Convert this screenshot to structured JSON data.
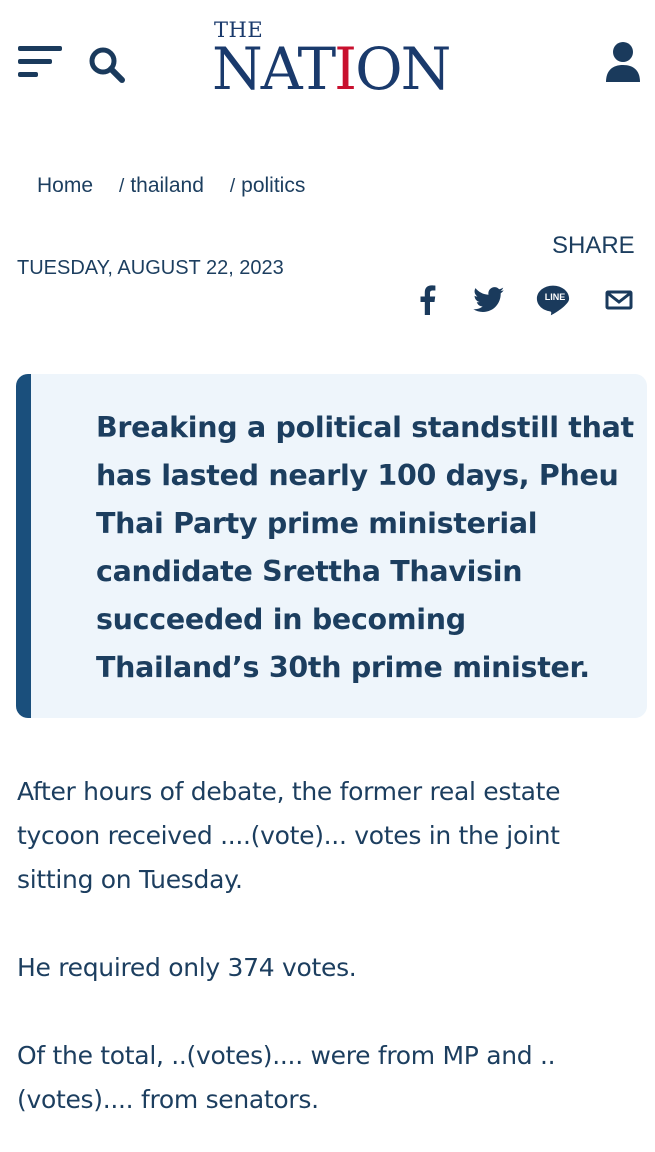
{
  "header": {
    "logo_top": "THE",
    "logo_main_before": "NAT",
    "logo_main_accent": "I",
    "logo_main_after": "ON",
    "menu_icon": "hamburger-icon",
    "search_icon": "search-icon",
    "user_icon": "user-icon",
    "brand_blue": "#1a3a6c",
    "brand_red": "#c8102e"
  },
  "breadcrumb": {
    "items": [
      {
        "label": "Home"
      },
      {
        "label": "thailand"
      },
      {
        "label": "politics"
      }
    ],
    "separator": "/"
  },
  "article": {
    "date": "TUESDAY, AUGUST 22, 2023",
    "share_label": "SHARE",
    "share_icons": [
      "facebook-icon",
      "twitter-icon",
      "line-icon",
      "mail-icon"
    ],
    "line_text": "LINE",
    "lead": "Breaking a political standstill that has lasted nearly 100 days, Pheu Thai Party prime ministerial candidate Srettha Thavisin succeeded in becoming Thailand’s 30th prime minister.",
    "paragraphs": [
      "After hours of debate, the former real estate tycoon received ....(vote)... votes in the joint sitting on Tuesday.",
      "He required only 374 votes.",
      "Of the total, ..(votes).... were from MP and .. (votes).... from senators."
    ]
  }
}
